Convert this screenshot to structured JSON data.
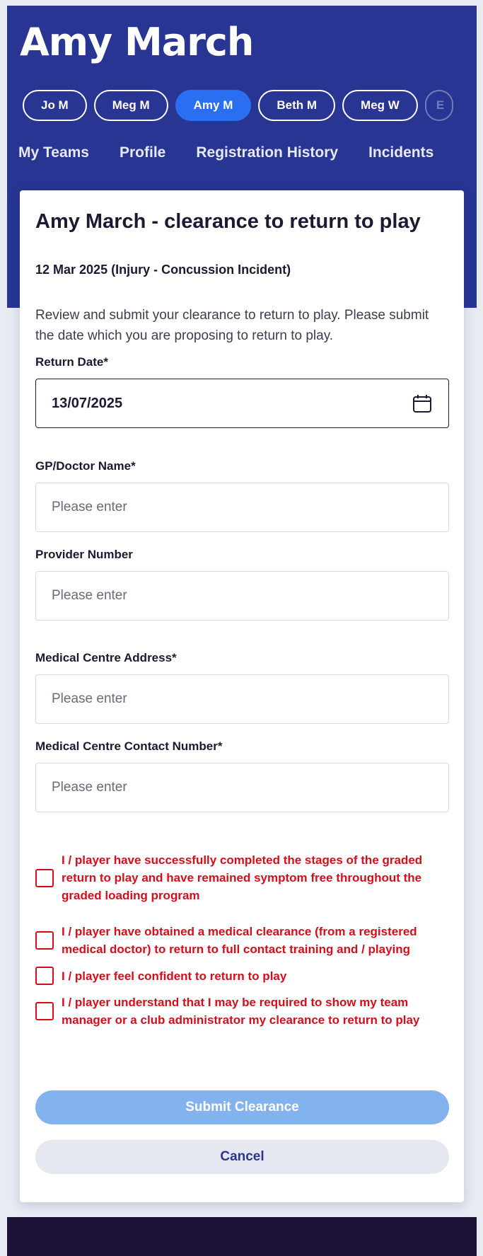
{
  "header": {
    "title": "Amy March",
    "players": [
      {
        "label": "Jo M",
        "active": false
      },
      {
        "label": "Meg M",
        "active": false
      },
      {
        "label": "Amy M",
        "active": true
      },
      {
        "label": "Beth M",
        "active": false
      },
      {
        "label": "Meg W",
        "active": false
      },
      {
        "label": "E",
        "active": false
      }
    ],
    "tabs": [
      "My Teams",
      "Profile",
      "Registration History",
      "Incidents"
    ]
  },
  "form": {
    "title": "Amy March - clearance to return to play",
    "incident": "12 Mar 2025 (Injury - Concussion Incident)",
    "intro": "Review and submit your clearance to return to play. Please submit the date which you are proposing to return to play.",
    "return_date": {
      "label": "Return Date*",
      "value": "13/07/2025"
    },
    "doctor_name": {
      "label": "GP/Doctor Name*",
      "placeholder": "Please enter"
    },
    "provider_number": {
      "label": "Provider Number",
      "placeholder": "Please enter"
    },
    "centre_address": {
      "label": "Medical Centre Address*",
      "placeholder": "Please enter"
    },
    "centre_contact": {
      "label": "Medical Centre Contact Number*",
      "placeholder": "Please enter"
    },
    "declarations": [
      "I / player have successfully completed the stages of the graded return to play and have remained symptom free throughout the graded loading program",
      "I / player have obtained a medical clearance (from a registered medical doctor) to return to full contact training and / playing",
      "I / player feel confident to return to play",
      "I / player understand that I may be required to show my team manager or a club administrator my clearance to return to play"
    ],
    "submit_label": "Submit Clearance",
    "cancel_label": "Cancel"
  },
  "colors": {
    "header_bg": "#283593",
    "active_pill": "#2a6ef1",
    "error_red": "#d40f1b",
    "submit_disabled": "#83b3ef"
  }
}
